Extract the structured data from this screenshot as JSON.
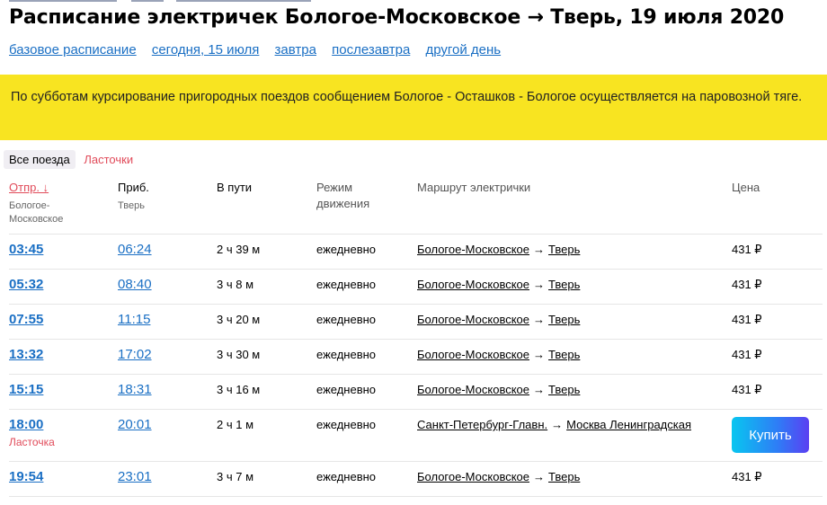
{
  "title": "Расписание электричек Бологое-Московское → Тверь, 19 июля 2020",
  "day_nav": [
    "базовое расписание",
    "сегодня, 15 июля",
    "завтра",
    "послезавтра",
    "другой день"
  ],
  "notice": "По субботам курсирование пригородных поездов сообщением Бологое - Осташков - Бологое осуществляется на паровозной тяге.",
  "filters": {
    "all": "Все поезда",
    "lastochki": "Ласточки"
  },
  "headers": {
    "dep": "Отпр. ↓",
    "dep_sub": "Бологое-Московское",
    "arr": "Приб.",
    "arr_sub": "Тверь",
    "dur": "В пути",
    "mode": "Режим движения",
    "route": "Маршрут электрички",
    "price": "Цена"
  },
  "rows": [
    {
      "dep": "03:45",
      "arr": "06:24",
      "dur": "2 ч 39 м",
      "mode": "ежедневно",
      "from": "Бологое-Московское",
      "to": "Тверь",
      "price": "431 ₽"
    },
    {
      "dep": "05:32",
      "arr": "08:40",
      "dur": "3 ч 8 м",
      "mode": "ежедневно",
      "from": "Бологое-Московское",
      "to": "Тверь",
      "price": "431 ₽"
    },
    {
      "dep": "07:55",
      "arr": "11:15",
      "dur": "3 ч 20 м",
      "mode": "ежедневно",
      "from": "Бологое-Московское",
      "to": "Тверь",
      "price": "431 ₽"
    },
    {
      "dep": "13:32",
      "arr": "17:02",
      "dur": "3 ч 30 м",
      "mode": "ежедневно",
      "from": "Бологое-Московское",
      "to": "Тверь",
      "price": "431 ₽"
    },
    {
      "dep": "15:15",
      "arr": "18:31",
      "dur": "3 ч 16 м",
      "mode": "ежедневно",
      "from": "Бологое-Московское",
      "to": "Тверь",
      "price": "431 ₽"
    },
    {
      "dep": "18:00",
      "arr": "20:01",
      "dur": "2 ч 1 м",
      "mode": "ежедневно",
      "from": "Санкт-Петербург-Главн.",
      "to": "Москва Ленинградская",
      "badge": "Ласточка",
      "button": "Купить"
    },
    {
      "dep": "19:54",
      "arr": "23:01",
      "dur": "3 ч 7 м",
      "mode": "ежедневно",
      "from": "Бологое-Московское",
      "to": "Тверь",
      "price": "431 ₽"
    }
  ],
  "route_arrow": "→",
  "colors": {
    "link": "#1a6fc4",
    "accent_red": "#e14b5a",
    "notice_bg": "#f8e421"
  }
}
